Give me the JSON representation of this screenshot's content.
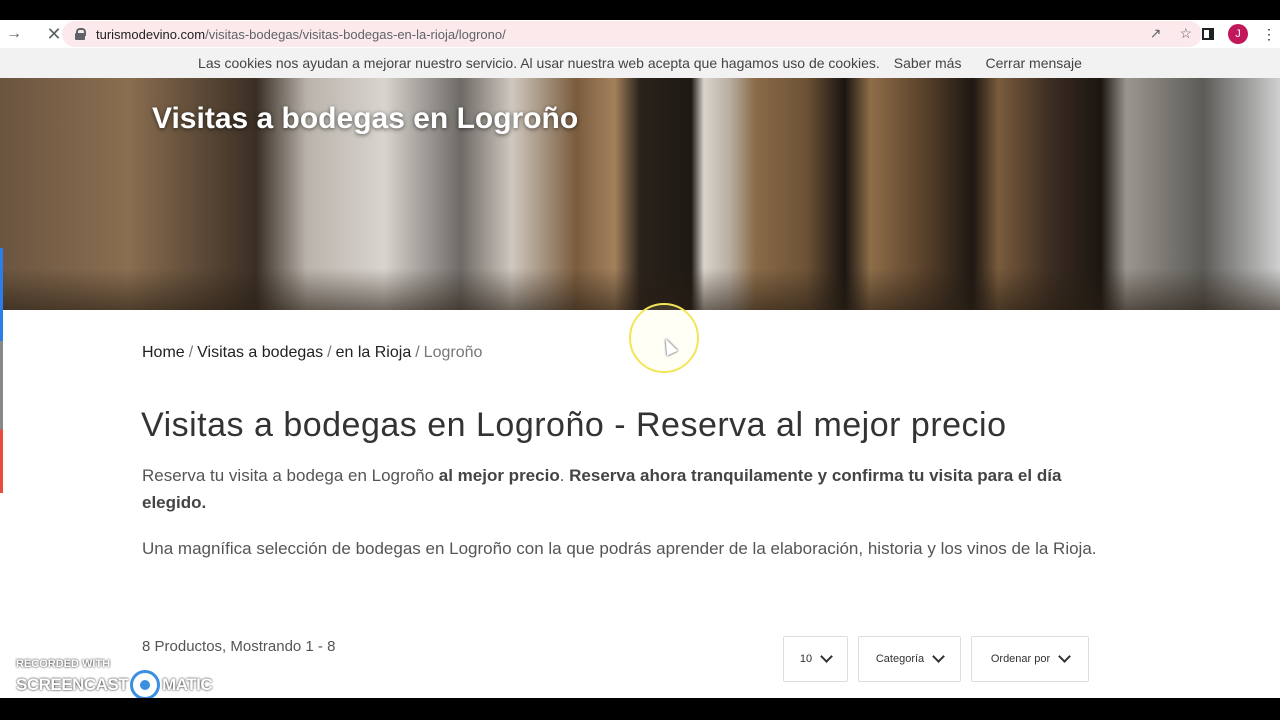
{
  "browser": {
    "url_host": "turismodevino.com",
    "url_path": "/visitas-bodegas/visitas-bodegas-en-la-rioja/logrono/",
    "avatar_letter": "J"
  },
  "cookie": {
    "message": "Las cookies nos ayudan a mejorar nuestro servicio. Al usar nuestra web acepta que hagamos uso de cookies.",
    "more_link": "Saber más",
    "close_link": "Cerrar mensaje"
  },
  "hero": {
    "title": "Visitas a bodegas en Logroño"
  },
  "breadcrumb": {
    "items": [
      "Home",
      "Visitas a bodegas",
      "en la Rioja"
    ],
    "current": "Logroño",
    "separator": "/"
  },
  "main": {
    "title": "Visitas a bodegas en Logroño - Reserva al mejor precio",
    "intro_plain": "Reserva tu visita a bodega en Logroño ",
    "intro_bold1": "al mejor precio",
    "intro_dot": ". ",
    "intro_bold2": "Reserva ahora tranquilamente y confirma tu visita para el día elegido.",
    "description": "Una magnífica selección de bodegas en Logroño con la que podrás aprender de la elaboración, historia y los vinos de la Rioja."
  },
  "listing": {
    "count_text": "8 Productos, Mostrando 1 - 8",
    "per_page": "10",
    "category_label": "Categoría",
    "order_label": "Ordenar por"
  },
  "watermark": {
    "top": "RECORDED WITH",
    "left": "SCREENCAST",
    "right": "MATIC"
  },
  "colors": {
    "omnibox_bg": "#fbe9ec",
    "avatar": "#c2185b",
    "cursor_ring": "#f1e65a"
  }
}
